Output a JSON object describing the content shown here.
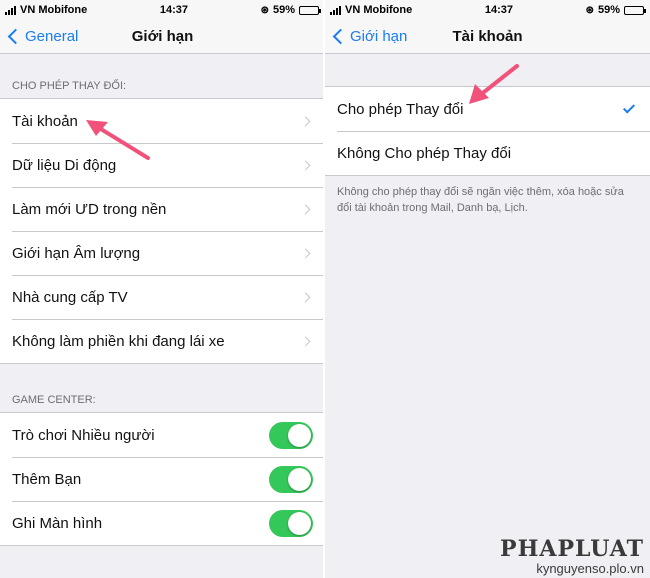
{
  "left": {
    "status": {
      "carrier": "VN Mobifone",
      "time": "14:37",
      "battery": "59%",
      "battery_level": 0.59
    },
    "nav": {
      "back_label": "General",
      "title": "Giới hạn"
    },
    "section_allow": "CHO PHÉP THAY ĐỔI:",
    "allow_items": [
      {
        "label": "Tài khoản"
      },
      {
        "label": "Dữ liệu Di động"
      },
      {
        "label": "Làm mới ƯD trong nền"
      },
      {
        "label": "Giới hạn Âm lượng"
      },
      {
        "label": "Nhà cung cấp TV"
      },
      {
        "label": "Không làm phiền khi đang lái xe"
      }
    ],
    "section_game": "GAME CENTER:",
    "game_items": [
      {
        "label": "Trò chơi Nhiều người",
        "on": true
      },
      {
        "label": "Thêm Bạn",
        "on": true
      },
      {
        "label": "Ghi Màn hình",
        "on": true
      }
    ]
  },
  "right": {
    "status": {
      "carrier": "VN Mobifone",
      "time": "14:37",
      "battery": "59%",
      "battery_level": 0.59
    },
    "nav": {
      "back_label": "Giới hạn",
      "title": "Tài khoản"
    },
    "options": [
      {
        "label": "Cho phép Thay đổi",
        "selected": true
      },
      {
        "label": "Không Cho phép Thay đổi",
        "selected": false
      }
    ],
    "note": "Không cho phép thay đổi sẽ ngăn việc thêm, xóa hoặc sửa đổi tài khoản trong Mail, Danh bạ, Lịch."
  },
  "watermark": {
    "logo": "PHAPLUAT",
    "site": "kynguyenso.plo.vn"
  },
  "colors": {
    "accent": "#1a7cf5",
    "toggle_on": "#34c759",
    "arrow": "#f0527a",
    "background": "#efeff4"
  }
}
